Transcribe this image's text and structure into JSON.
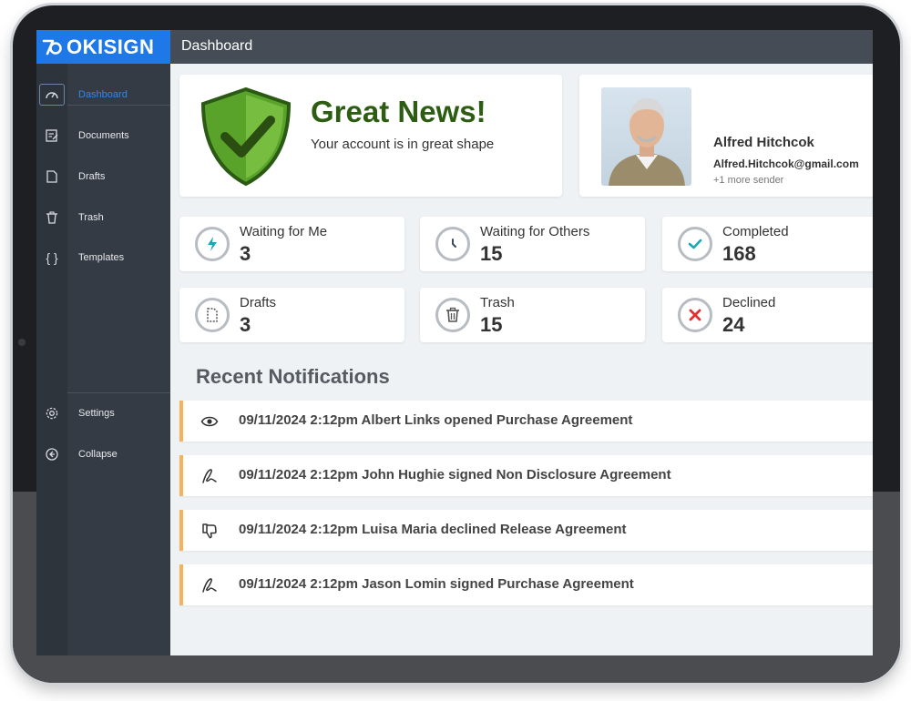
{
  "app": {
    "brand": "OKISIGN",
    "page_title": "Dashboard"
  },
  "sidebar": {
    "items": [
      {
        "label": "Dashboard",
        "icon": "gauge-icon",
        "active": true
      },
      {
        "label": "Documents",
        "icon": "document-edit-icon"
      },
      {
        "label": "Drafts",
        "icon": "draft-file-icon"
      },
      {
        "label": "Trash",
        "icon": "trash-icon"
      },
      {
        "label": "Templates",
        "icon": "braces-icon"
      }
    ],
    "bottom_items": [
      {
        "label": "Settings",
        "icon": "gear-icon"
      },
      {
        "label": "Collapse",
        "icon": "arrow-left-circle-icon"
      }
    ]
  },
  "hero": {
    "title": "Great News!",
    "subtitle": "Your account is in great shape"
  },
  "profile": {
    "name": "Alfred Hitchcok",
    "email": "Alfred.Hitchcok@gmail.com",
    "more": "+1 more sender"
  },
  "stats": [
    {
      "label": "Waiting for Me",
      "value": "3",
      "icon": "lightning-icon",
      "color": "#1aa7b8"
    },
    {
      "label": "Waiting for Others",
      "value": "15",
      "icon": "clock-icon",
      "color": "#3b4a60"
    },
    {
      "label": "Completed",
      "value": "168",
      "icon": "check-icon",
      "color": "#1aa7b8"
    },
    {
      "label": "Drafts",
      "value": "3",
      "icon": "draft-file-icon",
      "color": "#555"
    },
    {
      "label": "Trash",
      "value": "15",
      "icon": "trash-icon",
      "color": "#555"
    },
    {
      "label": "Declined",
      "value": "24",
      "icon": "x-icon",
      "color": "#e0312f"
    }
  ],
  "notifications": {
    "title": "Recent Notifications",
    "items": [
      {
        "text": "09/11/2024 2:12pm Albert Links opened Purchase Agreement",
        "icon": "eye-icon"
      },
      {
        "text": "09/11/2024 2:12pm John Hughie signed Non Disclosure Agreement",
        "icon": "signature-icon"
      },
      {
        "text": "09/11/2024 2:12pm Luisa Maria declined Release Agreement",
        "icon": "thumbs-down-icon"
      },
      {
        "text": "09/11/2024 2:12pm Jason Lomin signed Purchase Agreement",
        "icon": "signature-icon"
      }
    ]
  },
  "colors": {
    "brand_blue": "#1e78e8",
    "shield_green": "#5aa32a",
    "accent_orange": "#f6b25a",
    "title_green": "#2c5d12"
  }
}
